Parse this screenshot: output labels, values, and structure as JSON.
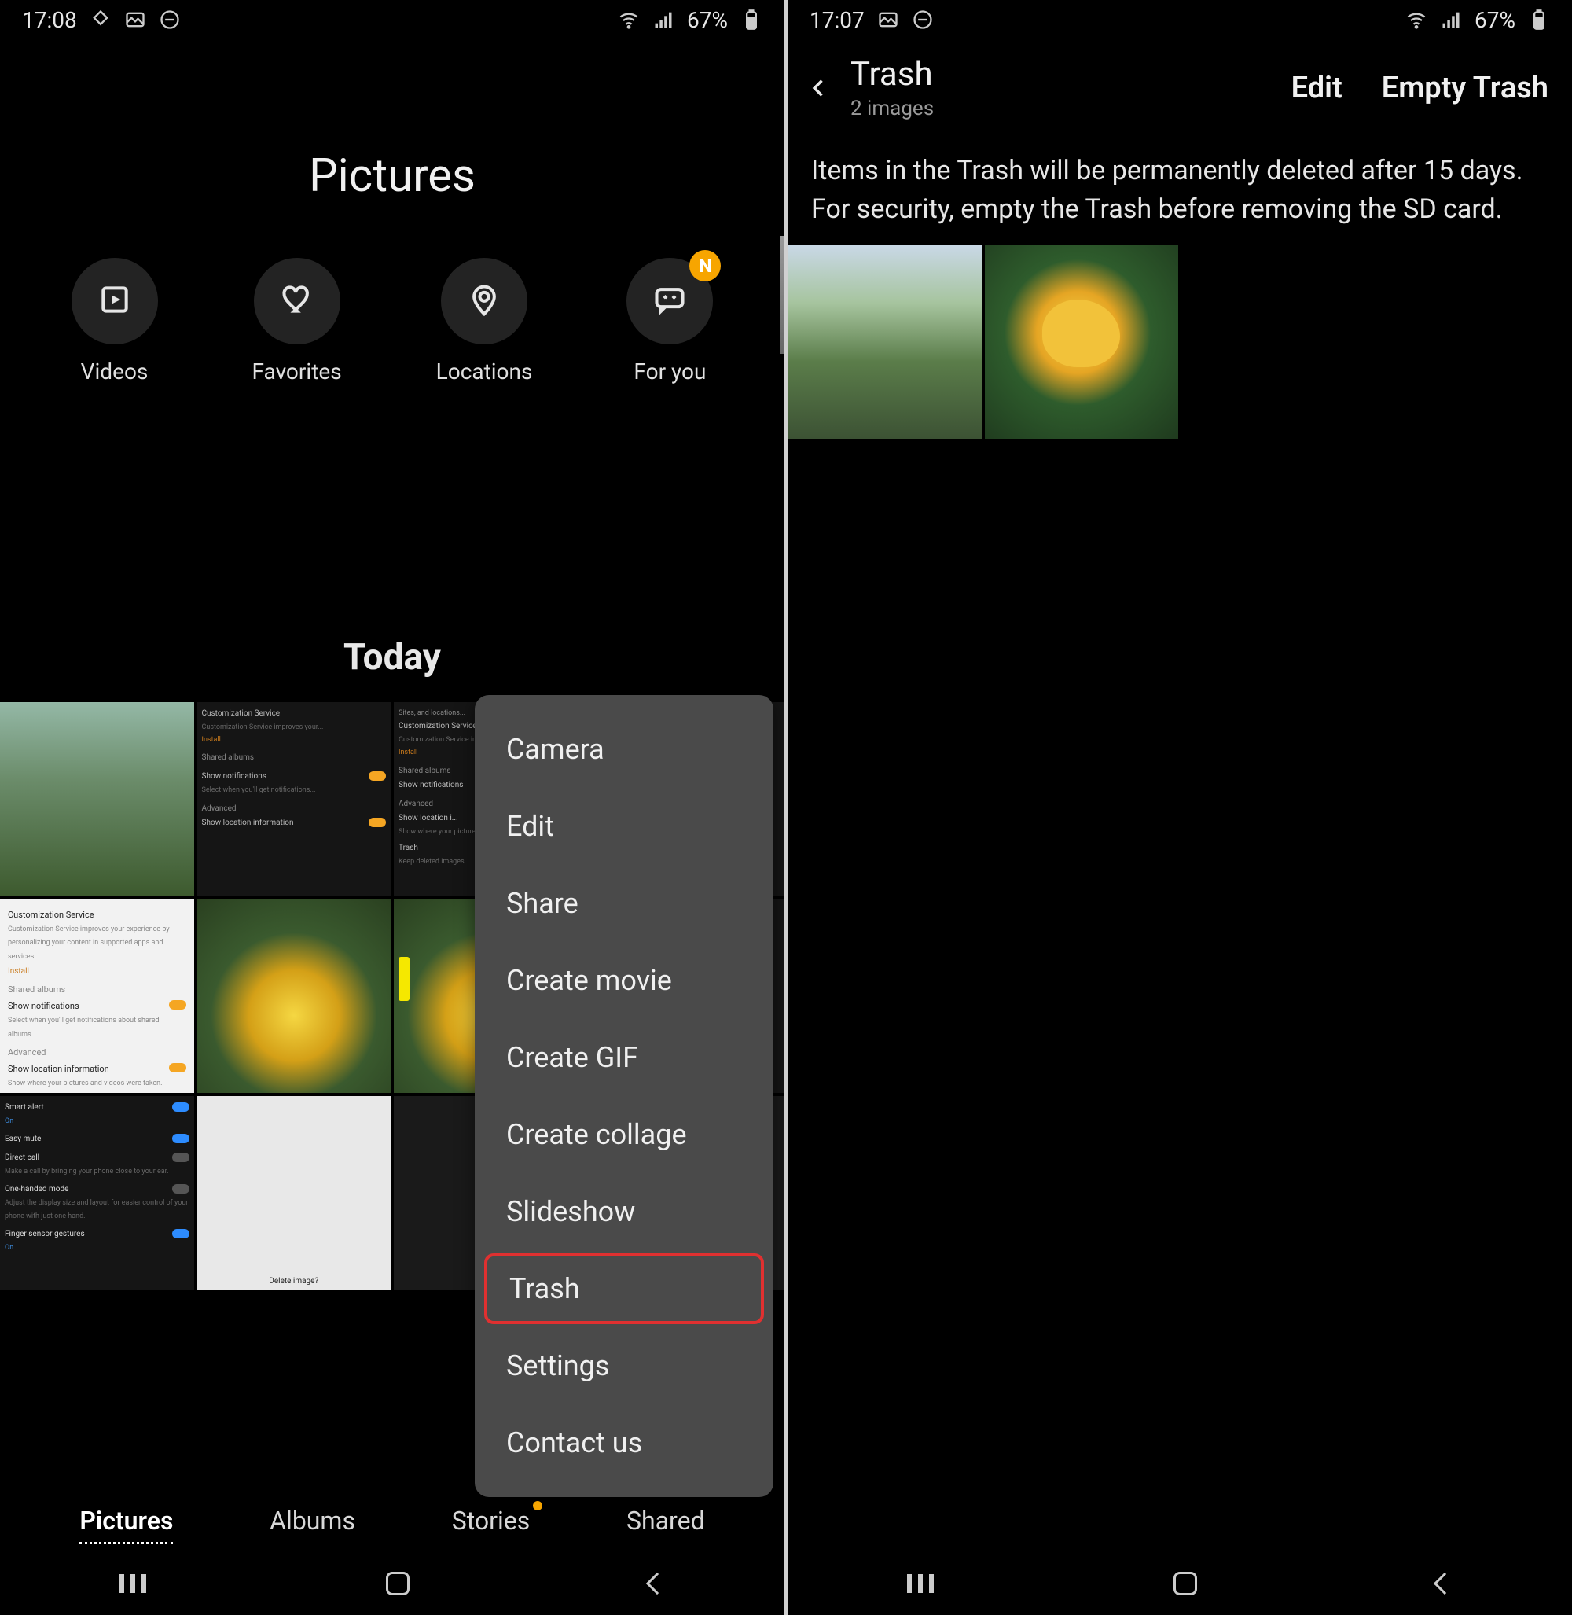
{
  "left": {
    "status": {
      "time": "17:08",
      "battery": "67%"
    },
    "title": "Pictures",
    "chips": [
      {
        "label": "Videos",
        "icon": "play-square-icon"
      },
      {
        "label": "Favorites",
        "icon": "heart-icon"
      },
      {
        "label": "Locations",
        "icon": "pin-icon"
      },
      {
        "label": "For you",
        "icon": "chat-stars-icon",
        "badge": "N"
      }
    ],
    "section": "Today",
    "popup": [
      "Camera",
      "Edit",
      "Share",
      "Create movie",
      "Create GIF",
      "Create collage",
      "Slideshow",
      "Trash",
      "Settings",
      "Contact us"
    ],
    "popup_highlight_index": 7,
    "tabs": [
      {
        "label": "Pictures",
        "selected": true
      },
      {
        "label": "Albums"
      },
      {
        "label": "Stories",
        "dot": true
      },
      {
        "label": "Shared"
      }
    ],
    "thumbs_settings_light": {
      "h1": "Customization Service",
      "h1_sub": "Customization Service improves your experience by personalizing your content in supported apps and services.",
      "install": "Install",
      "shared": "Shared albums",
      "notif": "Show notifications",
      "notif_sub": "Select when you'll get notifications about shared albums.",
      "adv": "Advanced",
      "loc": "Show location information",
      "loc_sub": "Show where your pictures and videos were taken.",
      "trash": "Trash"
    },
    "thumbs_settings_dark2": {
      "l1": "Smart alert",
      "l1_sub": "On",
      "l2": "Easy mute",
      "l3": "Direct call",
      "l3_sub": "Make a call by bringing your phone close to your ear.",
      "l4": "One-handed mode",
      "l4_sub": "Adjust the display size and layout for easier control of your phone with just one hand.",
      "l5": "Finger sensor gestures",
      "l5_sub": "On"
    }
  },
  "right": {
    "status": {
      "time": "17:07",
      "battery": "67%"
    },
    "title": "Trash",
    "subtitle": "2 images",
    "actions": {
      "edit": "Edit",
      "empty": "Empty Trash"
    },
    "info": "Items in the Trash will be permanently deleted after 15 days. For security, empty the Trash before removing the SD card."
  }
}
